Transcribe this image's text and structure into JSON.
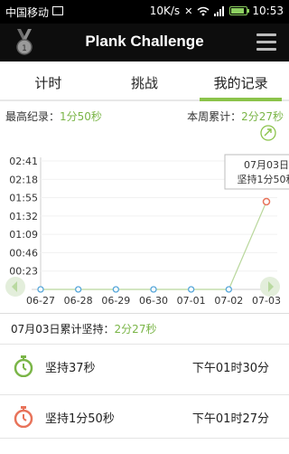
{
  "status_bar": {
    "carrier": "中国移动",
    "speed": "10K/s",
    "time": "10:53"
  },
  "header": {
    "title": "Plank Challenge"
  },
  "tabs": [
    {
      "label": "计时",
      "active": false
    },
    {
      "label": "挑战",
      "active": false
    },
    {
      "label": "我的记录",
      "active": true
    }
  ],
  "records": {
    "best_label": "最高纪录：",
    "best_value": "1分50秒",
    "week_label": "本周累计：",
    "week_value": "2分27秒"
  },
  "tooltip": {
    "date": "07月03日",
    "text": "坚持1分50秒"
  },
  "colors": {
    "accent": "#8bc34a",
    "accent_text": "#7ab547",
    "highlight_point": "#e8735a",
    "dark_header": "#0d0d0d"
  },
  "chart_data": {
    "type": "line",
    "categories": [
      "06-27",
      "06-28",
      "06-29",
      "06-30",
      "07-01",
      "07-02",
      "07-03"
    ],
    "values_seconds": [
      0,
      0,
      0,
      0,
      0,
      0,
      110
    ],
    "y_tick_labels": [
      "00:23",
      "00:46",
      "01:09",
      "01:32",
      "01:55",
      "02:18",
      "02:41"
    ],
    "y_tick_seconds": [
      23,
      46,
      69,
      92,
      115,
      138,
      161
    ],
    "ylim": [
      0,
      161
    ],
    "highlight_index": 6
  },
  "summary": {
    "label": "07月03日累计坚持：",
    "value": "2分27秒"
  },
  "sessions": [
    {
      "duration": "坚持37秒",
      "time": "下午01时30分",
      "icon": "stopwatch-green-icon",
      "color": "#7ab547"
    },
    {
      "duration": "坚持1分50秒",
      "time": "下午01时27分",
      "icon": "stopwatch-orange-icon",
      "color": "#e8735a"
    }
  ]
}
